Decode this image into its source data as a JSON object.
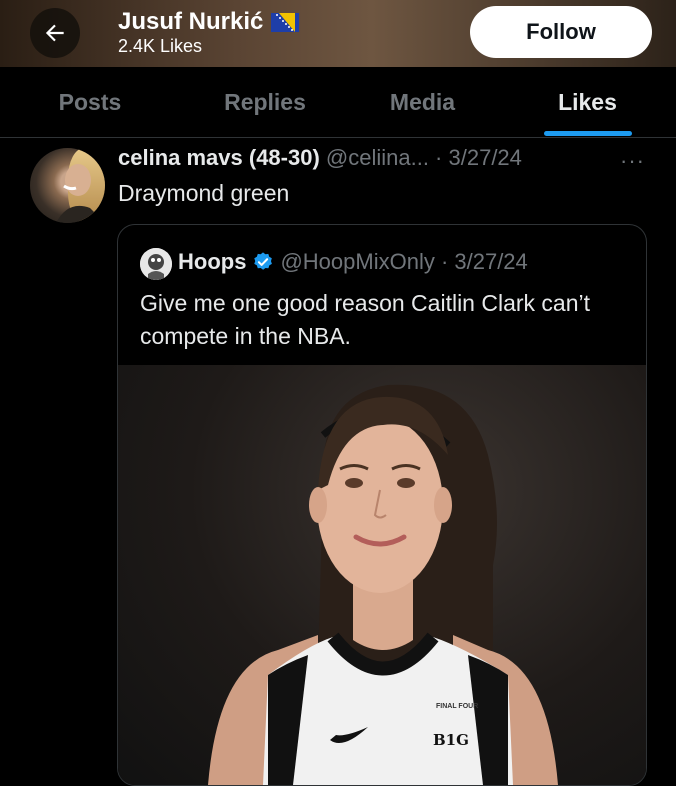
{
  "header": {
    "profile_name": "Jusuf Nurkić",
    "likes_count": "2.4K Likes",
    "follow_label": "Follow"
  },
  "tabs": [
    {
      "label": "Posts",
      "active": false
    },
    {
      "label": "Replies",
      "active": false
    },
    {
      "label": "Media",
      "active": false
    },
    {
      "label": "Likes",
      "active": true
    }
  ],
  "post": {
    "author_name": "celina mavs (48-30)",
    "author_meta": "@celiina... · 3/27/24",
    "more_label": "···",
    "text": "Draymond green",
    "quote": {
      "author_name": "Hoops",
      "author_meta": "@HoopMixOnly · 3/27/24",
      "text": "Give me one good reason Caitlin Clark can’t compete in the NBA.",
      "jersey_badge": "FINAL FOUR",
      "jersey_logo": "B1G"
    }
  },
  "colors": {
    "accent": "#1d9bf0",
    "background": "#000000",
    "muted_text": "#71767b",
    "primary_text": "#e7e9ea",
    "border": "#2f3336"
  },
  "icons": {
    "back": "arrow-left-icon",
    "flag": "bosnia-flag-icon",
    "verified": "verified-badge-icon",
    "more": "more-horizontal-icon"
  }
}
